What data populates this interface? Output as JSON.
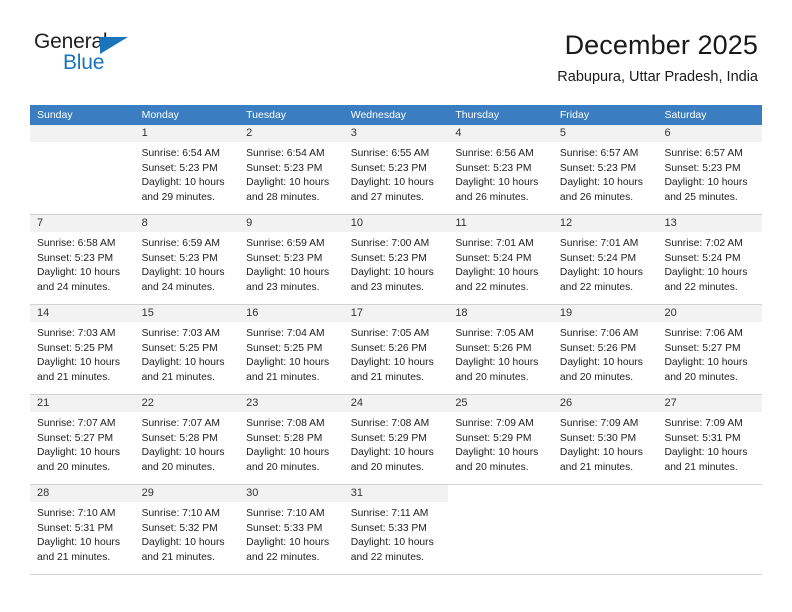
{
  "logo": {
    "word_general": "General",
    "word_blue": "Blue",
    "triangle_color": "#1b75bb"
  },
  "header": {
    "title": "December 2025",
    "subtitle": "Rabupura, Uttar Pradesh, India"
  },
  "theme": {
    "header_row_bg": "#3a7dc0",
    "day_band_bg": "#f2f2f2",
    "grid_line": "#d2d2d2",
    "text": "#222222"
  },
  "weekdays": [
    "Sunday",
    "Monday",
    "Tuesday",
    "Wednesday",
    "Thursday",
    "Friday",
    "Saturday"
  ],
  "weeks": [
    [
      {
        "day": "",
        "lines": []
      },
      {
        "day": "1",
        "lines": [
          "Sunrise: 6:54 AM",
          "Sunset: 5:23 PM",
          "Daylight: 10 hours",
          "and 29 minutes."
        ]
      },
      {
        "day": "2",
        "lines": [
          "Sunrise: 6:54 AM",
          "Sunset: 5:23 PM",
          "Daylight: 10 hours",
          "and 28 minutes."
        ]
      },
      {
        "day": "3",
        "lines": [
          "Sunrise: 6:55 AM",
          "Sunset: 5:23 PM",
          "Daylight: 10 hours",
          "and 27 minutes."
        ]
      },
      {
        "day": "4",
        "lines": [
          "Sunrise: 6:56 AM",
          "Sunset: 5:23 PM",
          "Daylight: 10 hours",
          "and 26 minutes."
        ]
      },
      {
        "day": "5",
        "lines": [
          "Sunrise: 6:57 AM",
          "Sunset: 5:23 PM",
          "Daylight: 10 hours",
          "and 26 minutes."
        ]
      },
      {
        "day": "6",
        "lines": [
          "Sunrise: 6:57 AM",
          "Sunset: 5:23 PM",
          "Daylight: 10 hours",
          "and 25 minutes."
        ]
      }
    ],
    [
      {
        "day": "7",
        "lines": [
          "Sunrise: 6:58 AM",
          "Sunset: 5:23 PM",
          "Daylight: 10 hours",
          "and 24 minutes."
        ]
      },
      {
        "day": "8",
        "lines": [
          "Sunrise: 6:59 AM",
          "Sunset: 5:23 PM",
          "Daylight: 10 hours",
          "and 24 minutes."
        ]
      },
      {
        "day": "9",
        "lines": [
          "Sunrise: 6:59 AM",
          "Sunset: 5:23 PM",
          "Daylight: 10 hours",
          "and 23 minutes."
        ]
      },
      {
        "day": "10",
        "lines": [
          "Sunrise: 7:00 AM",
          "Sunset: 5:23 PM",
          "Daylight: 10 hours",
          "and 23 minutes."
        ]
      },
      {
        "day": "11",
        "lines": [
          "Sunrise: 7:01 AM",
          "Sunset: 5:24 PM",
          "Daylight: 10 hours",
          "and 22 minutes."
        ]
      },
      {
        "day": "12",
        "lines": [
          "Sunrise: 7:01 AM",
          "Sunset: 5:24 PM",
          "Daylight: 10 hours",
          "and 22 minutes."
        ]
      },
      {
        "day": "13",
        "lines": [
          "Sunrise: 7:02 AM",
          "Sunset: 5:24 PM",
          "Daylight: 10 hours",
          "and 22 minutes."
        ]
      }
    ],
    [
      {
        "day": "14",
        "lines": [
          "Sunrise: 7:03 AM",
          "Sunset: 5:25 PM",
          "Daylight: 10 hours",
          "and 21 minutes."
        ]
      },
      {
        "day": "15",
        "lines": [
          "Sunrise: 7:03 AM",
          "Sunset: 5:25 PM",
          "Daylight: 10 hours",
          "and 21 minutes."
        ]
      },
      {
        "day": "16",
        "lines": [
          "Sunrise: 7:04 AM",
          "Sunset: 5:25 PM",
          "Daylight: 10 hours",
          "and 21 minutes."
        ]
      },
      {
        "day": "17",
        "lines": [
          "Sunrise: 7:05 AM",
          "Sunset: 5:26 PM",
          "Daylight: 10 hours",
          "and 21 minutes."
        ]
      },
      {
        "day": "18",
        "lines": [
          "Sunrise: 7:05 AM",
          "Sunset: 5:26 PM",
          "Daylight: 10 hours",
          "and 20 minutes."
        ]
      },
      {
        "day": "19",
        "lines": [
          "Sunrise: 7:06 AM",
          "Sunset: 5:26 PM",
          "Daylight: 10 hours",
          "and 20 minutes."
        ]
      },
      {
        "day": "20",
        "lines": [
          "Sunrise: 7:06 AM",
          "Sunset: 5:27 PM",
          "Daylight: 10 hours",
          "and 20 minutes."
        ]
      }
    ],
    [
      {
        "day": "21",
        "lines": [
          "Sunrise: 7:07 AM",
          "Sunset: 5:27 PM",
          "Daylight: 10 hours",
          "and 20 minutes."
        ]
      },
      {
        "day": "22",
        "lines": [
          "Sunrise: 7:07 AM",
          "Sunset: 5:28 PM",
          "Daylight: 10 hours",
          "and 20 minutes."
        ]
      },
      {
        "day": "23",
        "lines": [
          "Sunrise: 7:08 AM",
          "Sunset: 5:28 PM",
          "Daylight: 10 hours",
          "and 20 minutes."
        ]
      },
      {
        "day": "24",
        "lines": [
          "Sunrise: 7:08 AM",
          "Sunset: 5:29 PM",
          "Daylight: 10 hours",
          "and 20 minutes."
        ]
      },
      {
        "day": "25",
        "lines": [
          "Sunrise: 7:09 AM",
          "Sunset: 5:29 PM",
          "Daylight: 10 hours",
          "and 20 minutes."
        ]
      },
      {
        "day": "26",
        "lines": [
          "Sunrise: 7:09 AM",
          "Sunset: 5:30 PM",
          "Daylight: 10 hours",
          "and 21 minutes."
        ]
      },
      {
        "day": "27",
        "lines": [
          "Sunrise: 7:09 AM",
          "Sunset: 5:31 PM",
          "Daylight: 10 hours",
          "and 21 minutes."
        ]
      }
    ],
    [
      {
        "day": "28",
        "lines": [
          "Sunrise: 7:10 AM",
          "Sunset: 5:31 PM",
          "Daylight: 10 hours",
          "and 21 minutes."
        ]
      },
      {
        "day": "29",
        "lines": [
          "Sunrise: 7:10 AM",
          "Sunset: 5:32 PM",
          "Daylight: 10 hours",
          "and 21 minutes."
        ]
      },
      {
        "day": "30",
        "lines": [
          "Sunrise: 7:10 AM",
          "Sunset: 5:33 PM",
          "Daylight: 10 hours",
          "and 22 minutes."
        ]
      },
      {
        "day": "31",
        "lines": [
          "Sunrise: 7:11 AM",
          "Sunset: 5:33 PM",
          "Daylight: 10 hours",
          "and 22 minutes."
        ]
      },
      {
        "day": "",
        "lines": []
      },
      {
        "day": "",
        "lines": []
      },
      {
        "day": "",
        "lines": []
      }
    ]
  ]
}
